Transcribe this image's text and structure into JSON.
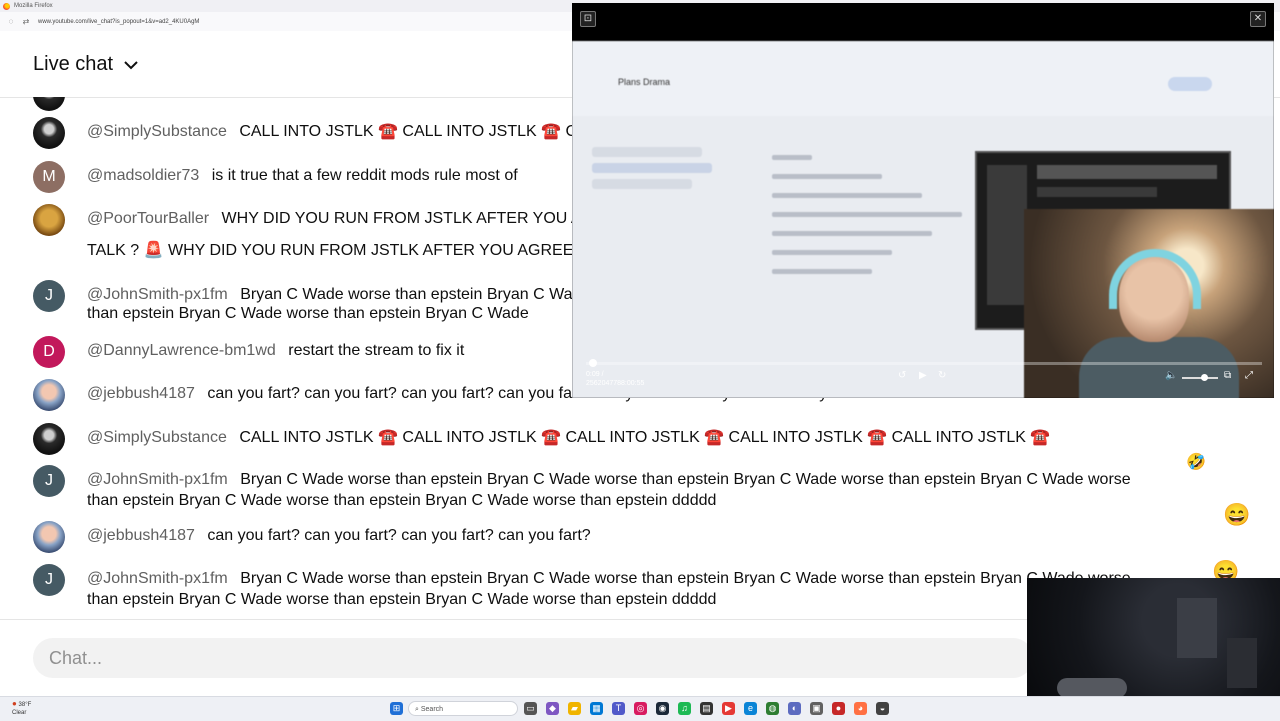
{
  "browser": {
    "window_title": "Mozilla Firefox",
    "url": "www.youtube.com/live_chat?is_popout=1&v=ad2_4KU0AgM"
  },
  "chat": {
    "title": "Live chat",
    "input_placeholder": "Chat...",
    "messages": [
      {
        "author": "@SimplySubstance",
        "text": "CALL INTO JSTLK ☎️ CALL INTO JSTLK ☎️ CALL INTO JSTLK ☎️ CALL INTO JSTLK ☎️ CALL INTO JSTLK ☎️",
        "avatar": "photo"
      },
      {
        "author": "@madsoldier73",
        "text": "is it true that a few reddit mods rule most of",
        "avatar": "M"
      },
      {
        "author": "@PoorTourBaller",
        "text": "WHY DID YOU RUN FROM JSTLK AFTER YOU AGREED TO",
        "text2": "TALK ? 🚨 WHY DID YOU RUN FROM JSTLK AFTER YOU AGREED TO TALK ?",
        "avatar": "photo"
      },
      {
        "author": "@JohnSmith-px1fm",
        "text": "Bryan C Wade worse than epstein Bryan C Wade worse than epstein Bryan C Wade worse",
        "text2": "than epstein Bryan C Wade worse than epstein Bryan C Wade",
        "avatar": "J"
      },
      {
        "author": "@DannyLawrence-bm1wd",
        "text": "restart the stream to fix it",
        "avatar": "D"
      },
      {
        "author": "@jebbush4187",
        "text": "can you fart? can you fart? can you fart? can you fart? can you fart? can you fart? can you fart?",
        "avatar": "photo"
      },
      {
        "author": "@SimplySubstance",
        "text": "CALL INTO JSTLK ☎️ CALL INTO JSTLK ☎️ CALL INTO JSTLK ☎️ CALL INTO JSTLK ☎️ CALL INTO JSTLK ☎️",
        "avatar": "photo"
      },
      {
        "author": "@JohnSmith-px1fm",
        "text": "Bryan C Wade worse than epstein Bryan C Wade worse than epstein Bryan C Wade worse than epstein Bryan C Wade worse",
        "text2": "than epstein Bryan C Wade worse than epstein Bryan C Wade worse than epstein ddddd",
        "avatar": "J"
      },
      {
        "author": "@jebbush4187",
        "text": "can you fart? can you fart? can you fart? can you fart?",
        "avatar": "photo"
      },
      {
        "author": "@JohnSmith-px1fm",
        "text": "Bryan C Wade worse than epstein Bryan C Wade worse than epstein Bryan C Wade worse than epstein Bryan C Wade worse",
        "text2": "than epstein Bryan C Wade worse than epstein Bryan C Wade worse than epstein ddddd",
        "avatar": "J"
      }
    ],
    "reaction_emojis": [
      "🤣",
      "😄",
      "😄"
    ]
  },
  "video_popup": {
    "time_current": "0:09 /",
    "time_total": "2562047788:00:55",
    "doc_title": "Plans Drama",
    "progress_fraction": 0.01,
    "volume_fraction": 0.6
  },
  "taskbar": {
    "weather_temp": "38°F",
    "weather_desc": "Clear",
    "search_placeholder": "Search"
  },
  "colors": {
    "author": "#606060",
    "text": "#0f0f0f",
    "input_bg": "#f2f2f2",
    "video_bg": "#000000"
  }
}
